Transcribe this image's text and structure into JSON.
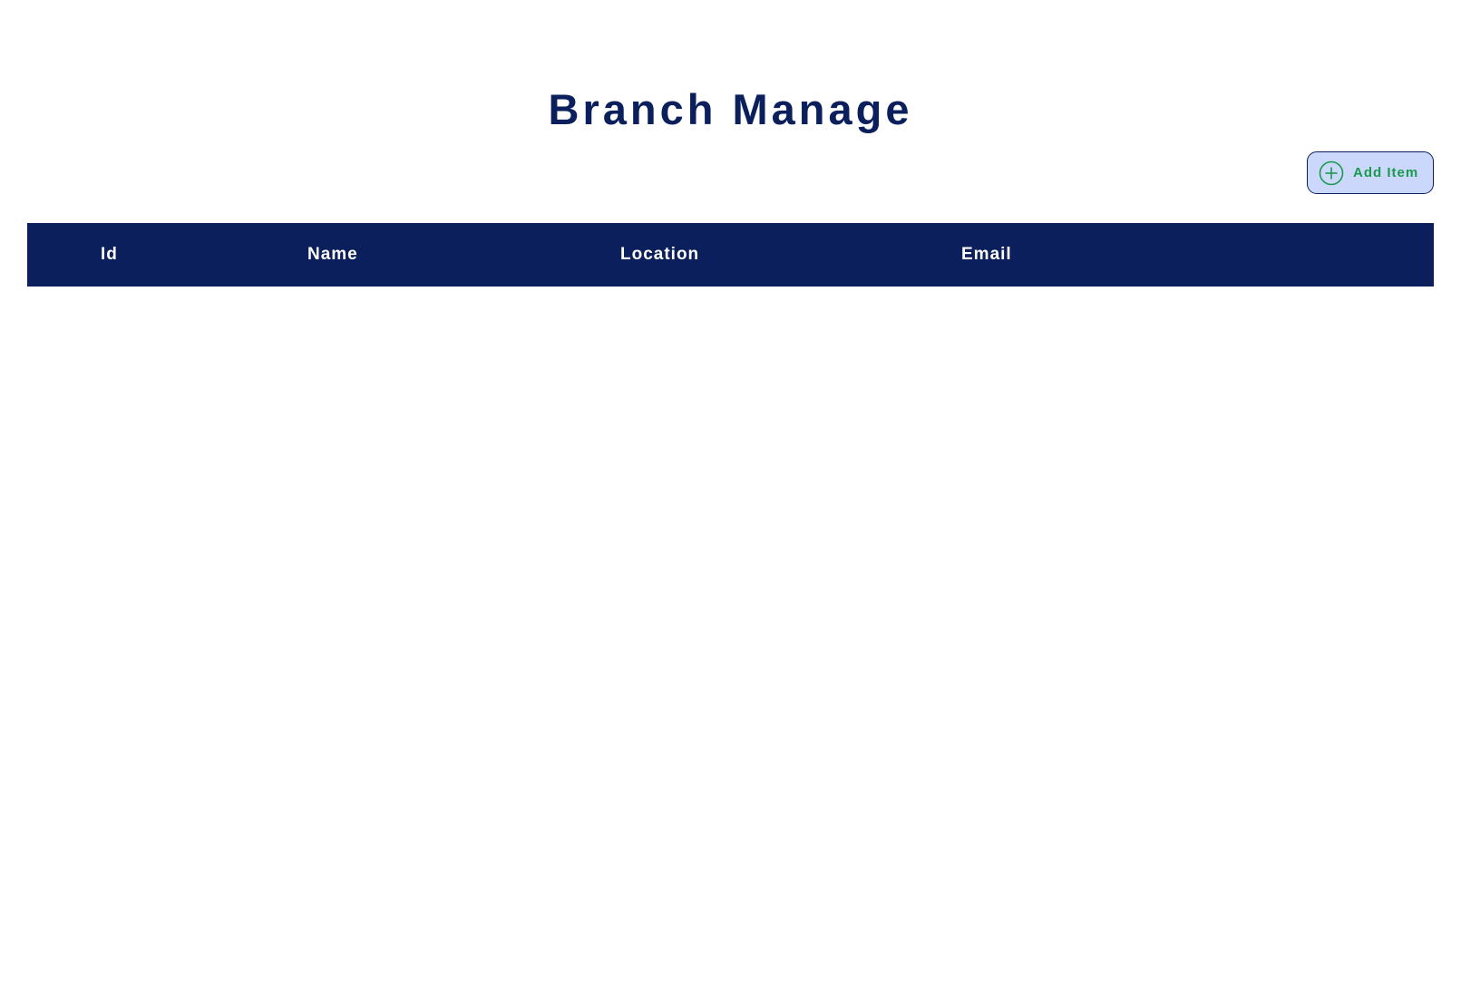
{
  "page": {
    "title": "Branch Manage"
  },
  "toolbar": {
    "add_button_label": "Add Item",
    "add_button_icon": "plus-circle-icon"
  },
  "table": {
    "columns": [
      "Id",
      "Name",
      "Location",
      "Email"
    ],
    "rows": []
  },
  "colors": {
    "primary": "#0a1f5c",
    "button_bg": "#cbd8fb",
    "accent_green": "#1a9a4e",
    "header_text": "#ffffff"
  }
}
